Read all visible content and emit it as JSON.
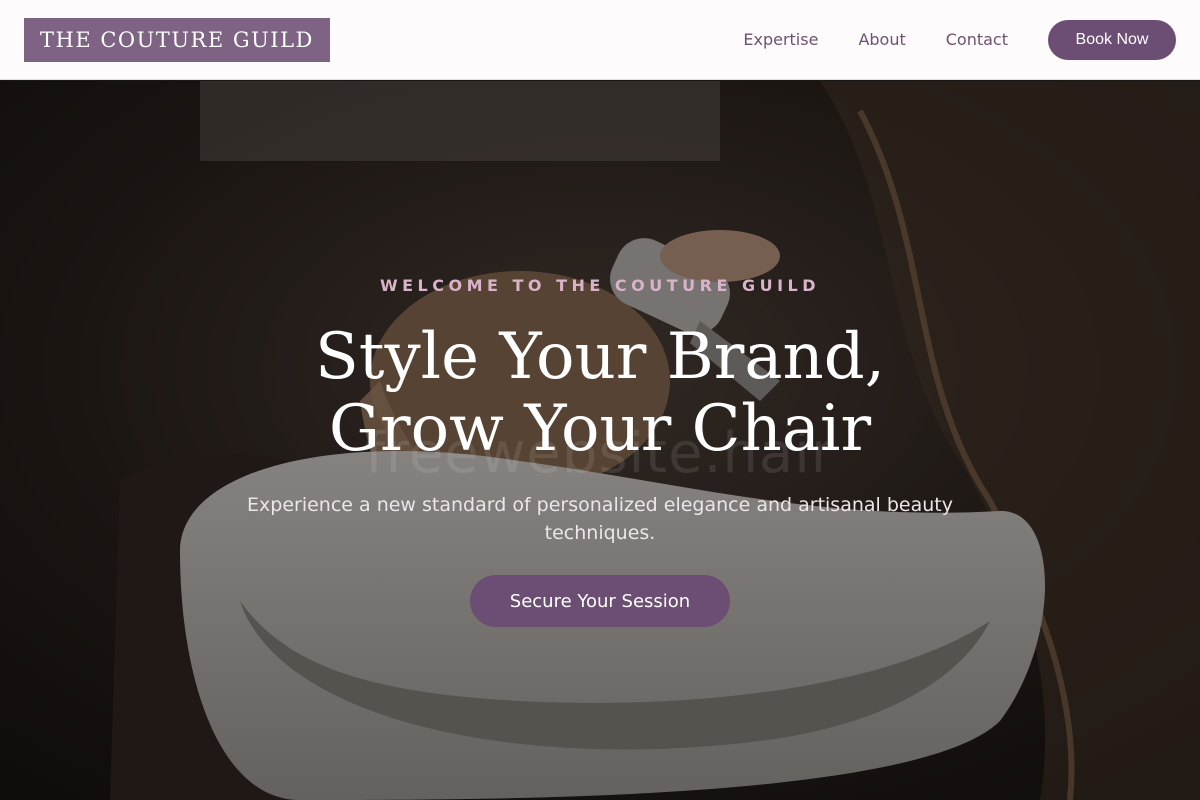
{
  "header": {
    "logo_text": "THE COUTURE GUILD",
    "nav": [
      {
        "label": "Expertise"
      },
      {
        "label": "About"
      },
      {
        "label": "Contact"
      }
    ],
    "book_button": "Book Now"
  },
  "hero": {
    "eyebrow": "WELCOME TO THE COUTURE GUILD",
    "headline": "Style Your Brand, Grow Your Chair",
    "subtext": "Experience a new standard of personalized elegance and artisanal beauty techniques.",
    "cta": "Secure Your Session",
    "watermark": "freewebsite.hair"
  },
  "colors": {
    "brand_purple": "#6c4d73",
    "logo_bg": "#7e6385",
    "eyebrow_pink": "#d9b3c9",
    "nav_text": "#6c5370"
  }
}
